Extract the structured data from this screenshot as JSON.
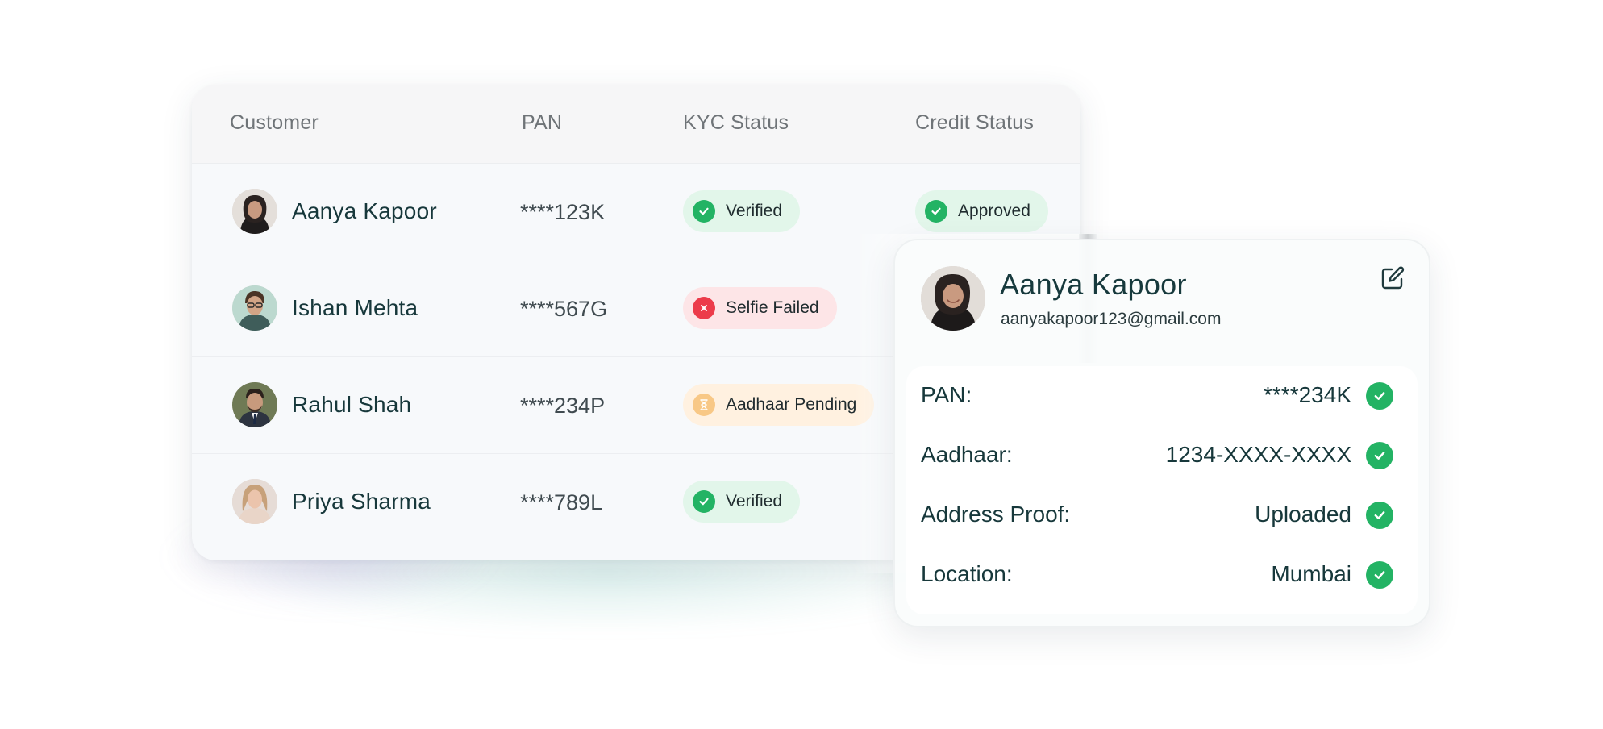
{
  "table": {
    "headers": {
      "customer": "Customer",
      "pan": "PAN",
      "kyc_status": "KYC Status",
      "credit_status": "Credit Status"
    },
    "rows": [
      {
        "name": "Aanya Kapoor",
        "pan": "****123K",
        "kyc": {
          "label": "Verified",
          "status": "success",
          "icon": "check-icon"
        },
        "credit": {
          "label": "Approved",
          "status": "success",
          "icon": "check-icon"
        }
      },
      {
        "name": "Ishan Mehta",
        "pan": "****567G",
        "kyc": {
          "label": "Selfie Failed",
          "status": "error",
          "icon": "x-icon"
        }
      },
      {
        "name": "Rahul Shah",
        "pan": "****234P",
        "kyc": {
          "label": "Aadhaar Pending",
          "status": "pending",
          "icon": "hourglass-icon"
        }
      },
      {
        "name": "Priya Sharma",
        "pan": "****789L",
        "kyc": {
          "label": "Verified",
          "status": "success",
          "icon": "check-icon"
        }
      }
    ]
  },
  "detail": {
    "name": "Aanya Kapoor",
    "email": "aanyakapoor123@gmail.com",
    "edit_icon": "edit-icon",
    "fields": [
      {
        "label": "PAN:",
        "value": "****234K",
        "verified": true
      },
      {
        "label": "Aadhaar:",
        "value": "1234-XXXX-XXXX",
        "verified": true
      },
      {
        "label": "Address Proof:",
        "value": "Uploaded",
        "verified": true
      },
      {
        "label": "Location:",
        "value": "Mumbai",
        "verified": true
      }
    ]
  },
  "colors": {
    "success": "#23b364",
    "success_bg": "#e2f6ea",
    "error": "#ec3b4a",
    "error_bg": "#fde5e7",
    "pending": "#f8c886",
    "pending_bg": "#fff1e0",
    "text_primary": "#17383b"
  }
}
